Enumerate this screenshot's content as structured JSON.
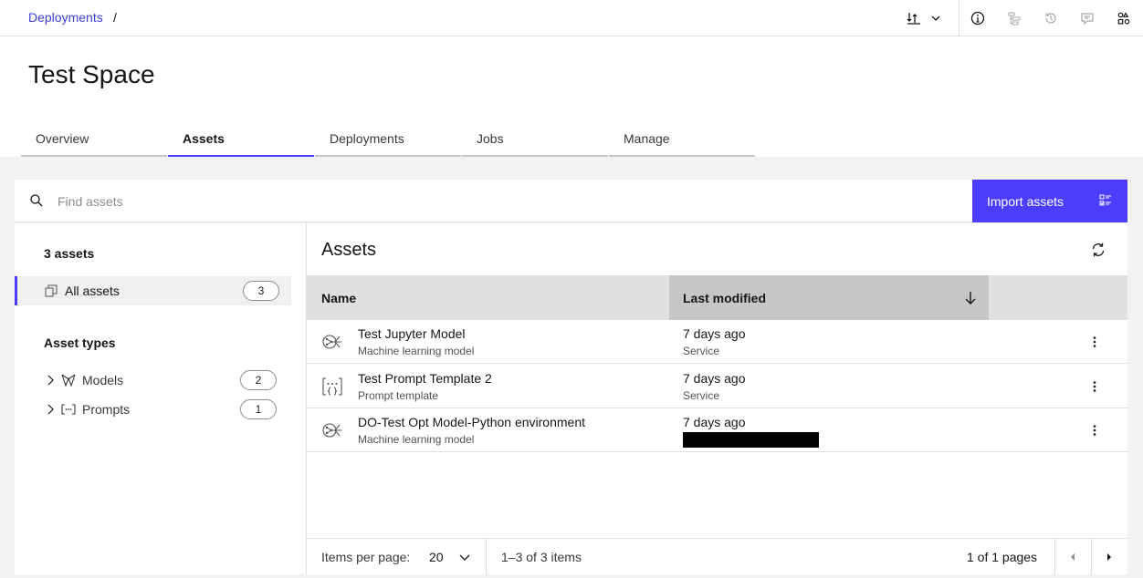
{
  "breadcrumb": {
    "root": "Deployments",
    "separator": "/"
  },
  "page": {
    "title": "Test Space"
  },
  "tabs": [
    {
      "label": "Overview",
      "active": false
    },
    {
      "label": "Assets",
      "active": true
    },
    {
      "label": "Deployments",
      "active": false
    },
    {
      "label": "Jobs",
      "active": false
    },
    {
      "label": "Manage",
      "active": false
    }
  ],
  "search": {
    "placeholder": "Find assets"
  },
  "import": {
    "label": "Import assets"
  },
  "sidebar": {
    "count_label": "3 assets",
    "all_assets": {
      "label": "All assets",
      "count": "3"
    },
    "types_title": "Asset types",
    "types": [
      {
        "label": "Models",
        "count": "2"
      },
      {
        "label": "Prompts",
        "count": "1"
      }
    ]
  },
  "table": {
    "title": "Assets",
    "columns": {
      "name": "Name",
      "modified": "Last modified"
    },
    "rows": [
      {
        "name": "Test Jupyter Model",
        "type": "Machine learning model",
        "modified": "7 days ago",
        "by": "Service",
        "icon": "model-icon"
      },
      {
        "name": "Test Prompt Template 2",
        "type": "Prompt template",
        "modified": "7 days ago",
        "by": "Service",
        "icon": "prompt-icon"
      },
      {
        "name": "DO-Test Opt Model-Python environment",
        "type": "Machine learning model",
        "modified": "7 days ago",
        "by": "",
        "icon": "model-icon"
      }
    ]
  },
  "pagination": {
    "items_per_page_label": "Items per page:",
    "items_per_page": "20",
    "range": "1–3 of 3 items",
    "pages": "1 of 1 pages"
  },
  "colors": {
    "accent": "#4b3dfc",
    "link": "#3d3ddc"
  }
}
